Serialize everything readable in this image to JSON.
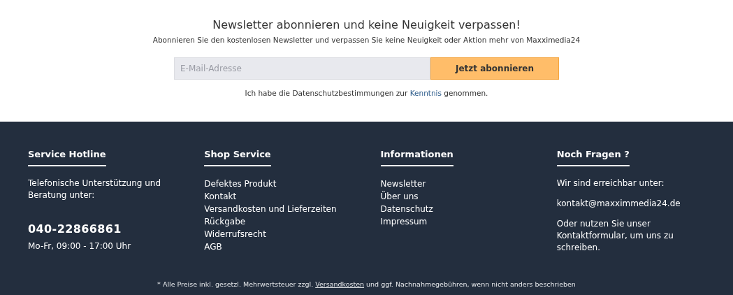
{
  "newsletter": {
    "title": "Newsletter abonnieren und keine Neuigkeit verpassen!",
    "subtitle": "Abonnieren Sie den kostenlosen Newsletter und verpassen Sie keine Neuigkeit oder Aktion mehr von Maxximedia24",
    "email": {
      "placeholder": "E-Mail-Adresse"
    },
    "button": "Jetzt abonnieren",
    "privacy": {
      "before": "Ich habe die Datenschutzbestimmungen zur ",
      "link": "Kenntnis",
      "after": " genommen."
    }
  },
  "footer": {
    "columns": [
      {
        "title": "Service Hotline",
        "items": [
          {
            "kind": "text",
            "text": "Telefonische Unterstützung und Beratung unter:"
          },
          {
            "kind": "phone",
            "text": "040-22866861"
          },
          {
            "kind": "small",
            "text": "Mo-Fr, 09:00 - 17:00 Uhr"
          }
        ]
      },
      {
        "title": "Shop Service",
        "items": [
          {
            "kind": "link",
            "text": "Defektes Produkt"
          },
          {
            "kind": "link",
            "text": "Kontakt"
          },
          {
            "kind": "link",
            "text": "Versandkosten und Lieferzeiten"
          },
          {
            "kind": "link",
            "text": "Rückgabe"
          },
          {
            "kind": "link",
            "text": "Widerrufsrecht"
          },
          {
            "kind": "link",
            "text": "AGB"
          }
        ]
      },
      {
        "title": "Informationen",
        "items": [
          {
            "kind": "link",
            "text": "Newsletter"
          },
          {
            "kind": "link",
            "text": "Über uns"
          },
          {
            "kind": "link",
            "text": "Datenschutz"
          },
          {
            "kind": "link",
            "text": "Impressum"
          }
        ]
      },
      {
        "title": "Noch Fragen ?",
        "items": [
          {
            "kind": "text",
            "text": "Wir sind erreichbar unter:"
          },
          {
            "kind": "email",
            "text": "kontakt@maxximmedia24.de"
          },
          {
            "kind": "text",
            "text": "Oder nutzen Sie unser Kontaktformular, um uns zu schreiben."
          }
        ]
      }
    ],
    "note": {
      "before": "* Alle Preise inkl. gesetzl. Mehrwertsteuer zzgl. ",
      "link": "Versandkosten",
      "after": " und ggf. Nachnahmegebühren, wenn nicht anders beschrieben"
    }
  }
}
